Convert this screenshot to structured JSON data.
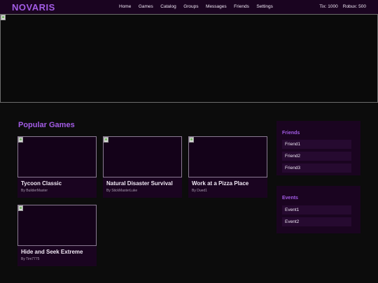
{
  "header": {
    "logo": "NOVARIS",
    "nav": [
      "Home",
      "Games",
      "Catalog",
      "Groups",
      "Messages",
      "Friends",
      "Settings"
    ],
    "tix": "Tix: 1000",
    "robux": "Robux: 500"
  },
  "main": {
    "section_title": "Popular Games",
    "games": [
      {
        "title": "Tycoon Classic",
        "author": "By BuilderMaster"
      },
      {
        "title": "Natural Disaster Survival",
        "author": "By StickMasterLuke"
      },
      {
        "title": "Work at a Pizza Place",
        "author": "By Dued1"
      },
      {
        "title": "Hide and Seek Extreme",
        "author": "By Tim7775"
      }
    ]
  },
  "sidebar": {
    "friends_title": "Friends",
    "friends": [
      "Friend1",
      "Friend2",
      "Friend3"
    ],
    "events_title": "Events",
    "events": [
      "Event1",
      "Event2"
    ]
  },
  "colors": {
    "accent": "#a35ce6",
    "panel": "#1a0420",
    "background": "#0c0c0c"
  }
}
